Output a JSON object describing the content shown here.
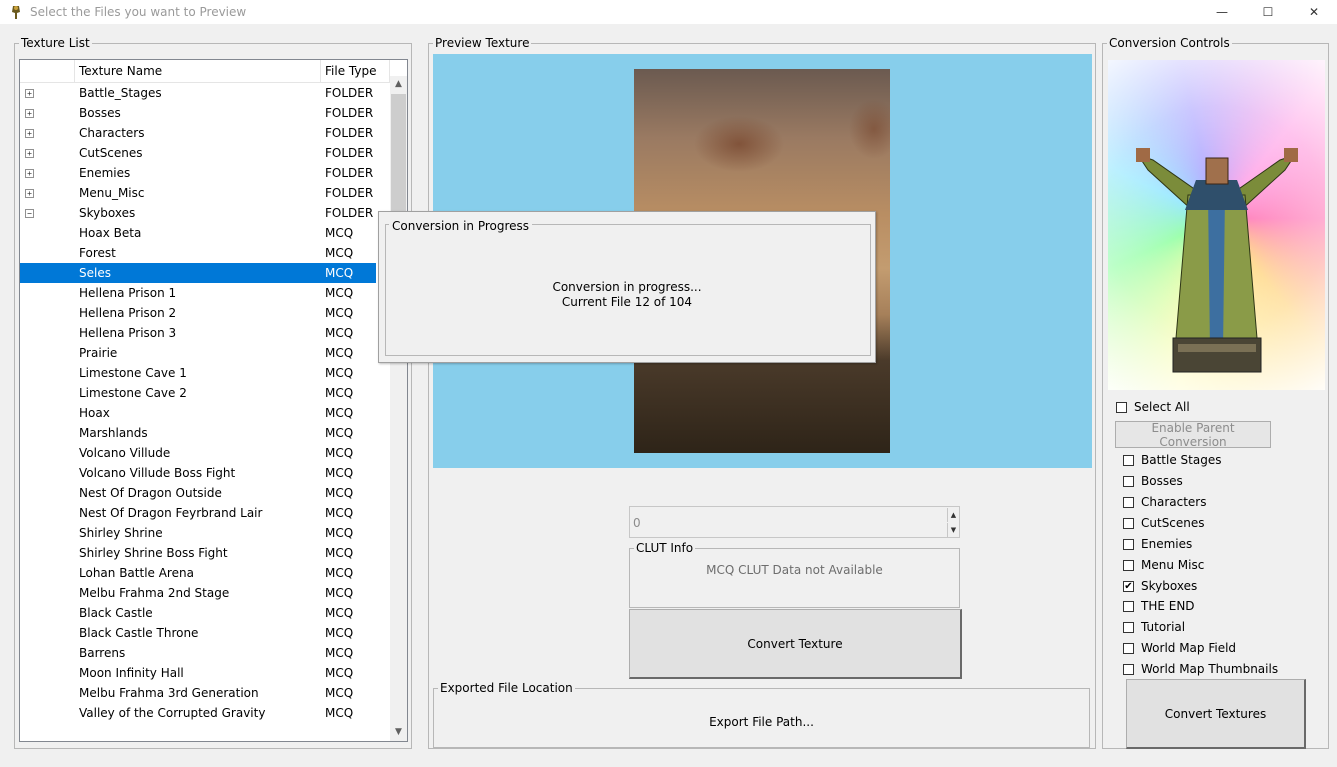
{
  "window": {
    "title": "Select the Files you want to Preview",
    "minimize_glyph": "—",
    "maximize_glyph": "☐",
    "close_glyph": "✕"
  },
  "texture_list": {
    "legend": "Texture List",
    "columns": [
      "Texture Name",
      "File Type"
    ],
    "rows": [
      {
        "name": "Battle_Stages",
        "type": "FOLDER",
        "expander": "+"
      },
      {
        "name": "Bosses",
        "type": "FOLDER",
        "expander": "+"
      },
      {
        "name": "Characters",
        "type": "FOLDER",
        "expander": "+"
      },
      {
        "name": "CutScenes",
        "type": "FOLDER",
        "expander": "+"
      },
      {
        "name": "Enemies",
        "type": "FOLDER",
        "expander": "+"
      },
      {
        "name": "Menu_Misc",
        "type": "FOLDER",
        "expander": "+"
      },
      {
        "name": "Skyboxes",
        "type": "FOLDER",
        "expander": "−"
      },
      {
        "name": "Hoax Beta",
        "type": "MCQ"
      },
      {
        "name": "Forest",
        "type": "MCQ"
      },
      {
        "name": "Seles",
        "type": "MCQ",
        "selected": true
      },
      {
        "name": "Hellena Prison 1",
        "type": "MCQ"
      },
      {
        "name": "Hellena Prison 2",
        "type": "MCQ"
      },
      {
        "name": "Hellena Prison 3",
        "type": "MCQ"
      },
      {
        "name": "Prairie",
        "type": "MCQ"
      },
      {
        "name": "Limestone Cave 1",
        "type": "MCQ"
      },
      {
        "name": "Limestone Cave 2",
        "type": "MCQ"
      },
      {
        "name": "Hoax",
        "type": "MCQ"
      },
      {
        "name": "Marshlands",
        "type": "MCQ"
      },
      {
        "name": "Volcano Villude",
        "type": "MCQ"
      },
      {
        "name": "Volcano Villude Boss Fight",
        "type": "MCQ"
      },
      {
        "name": "Nest Of Dragon Outside",
        "type": "MCQ"
      },
      {
        "name": "Nest Of Dragon Feyrbrand Lair",
        "type": "MCQ"
      },
      {
        "name": "Shirley Shrine",
        "type": "MCQ"
      },
      {
        "name": "Shirley Shrine Boss Fight",
        "type": "MCQ"
      },
      {
        "name": "Lohan Battle Arena",
        "type": "MCQ"
      },
      {
        "name": "Melbu Frahma 2nd Stage",
        "type": "MCQ"
      },
      {
        "name": "Black Castle",
        "type": "MCQ"
      },
      {
        "name": "Black Castle Throne",
        "type": "MCQ"
      },
      {
        "name": "Barrens",
        "type": "MCQ"
      },
      {
        "name": "Moon Infinity Hall",
        "type": "MCQ"
      },
      {
        "name": "Melbu Frahma 3rd Generation",
        "type": "MCQ"
      },
      {
        "name": "Valley of the Corrupted Gravity",
        "type": "MCQ"
      }
    ]
  },
  "preview": {
    "legend": "Preview Texture",
    "clut_value": "0",
    "clut_legend": "CLUT Info",
    "clut_message": "MCQ CLUT Data not Available",
    "convert_button": "Convert Texture",
    "export_legend": "Exported File Location",
    "export_button": "Export File Path..."
  },
  "progress_dialog": {
    "legend": "Conversion in Progress",
    "line1": "Conversion in progress...",
    "line2": "Current File 12 of 104"
  },
  "controls": {
    "legend": "Conversion Controls",
    "select_all": "Select All",
    "select_all_checked": false,
    "enable_parent_button": "Enable Parent Conversion",
    "categories": [
      {
        "label": "Battle Stages",
        "checked": false
      },
      {
        "label": "Bosses",
        "checked": false
      },
      {
        "label": "Characters",
        "checked": false
      },
      {
        "label": "CutScenes",
        "checked": false
      },
      {
        "label": "Enemies",
        "checked": false
      },
      {
        "label": "Menu Misc",
        "checked": false
      },
      {
        "label": "Skyboxes",
        "checked": true
      },
      {
        "label": "THE END",
        "checked": false
      },
      {
        "label": "Tutorial",
        "checked": false
      },
      {
        "label": "World Map Field",
        "checked": false
      },
      {
        "label": "World Map Thumbnails",
        "checked": false
      }
    ],
    "convert_all_button": "Convert Textures"
  },
  "icons": {
    "app": "app-icon",
    "expand": "expand-plus-icon",
    "collapse": "collapse-minus-icon",
    "scroll_up": "▲",
    "scroll_down": "▼",
    "spin_up": "▲",
    "spin_down": "▼",
    "check": "✔"
  },
  "colors": {
    "preview_bg": "#87ceeb",
    "selection": "#0078d7"
  }
}
